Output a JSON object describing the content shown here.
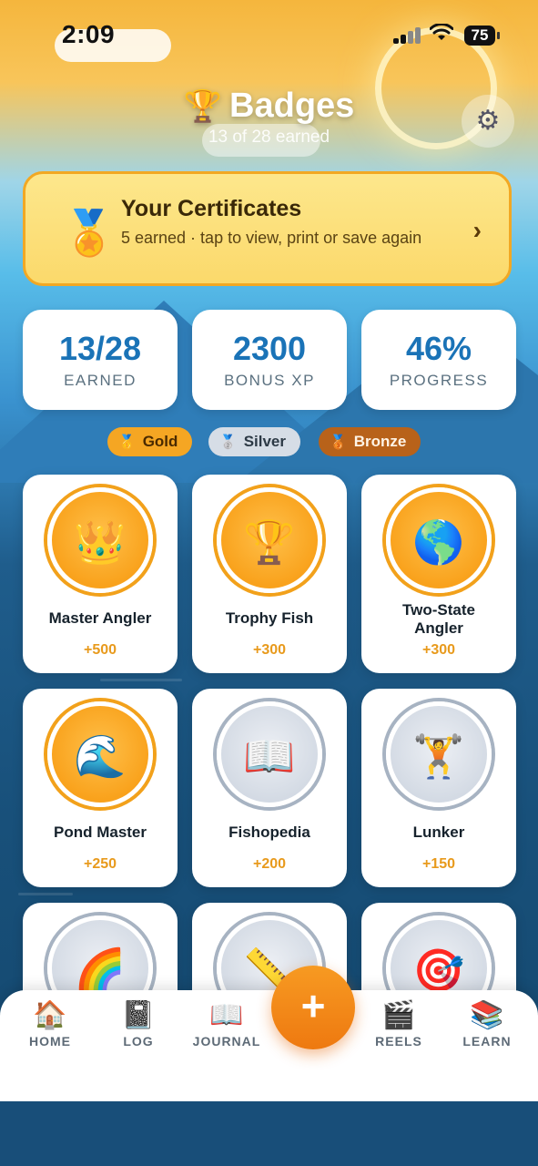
{
  "status_bar": {
    "time": "2:09",
    "battery": "75"
  },
  "header": {
    "title": "Badges",
    "subtitle": "13 of 28 earned"
  },
  "certificates": {
    "title": "Your Certificates",
    "description": "5 earned · tap to view, print or save again"
  },
  "stats": [
    {
      "value": "13/28",
      "label": "EARNED"
    },
    {
      "value": "2300",
      "label": "BONUS XP"
    },
    {
      "value": "46%",
      "label": "PROGRESS"
    }
  ],
  "legend": [
    {
      "label": "Gold",
      "icon": "gold-medal",
      "glyph": "🥇",
      "color": "#f5a623"
    },
    {
      "label": "Silver",
      "icon": "silver-medal",
      "glyph": "🥈",
      "color": "#d6dde6"
    },
    {
      "label": "Bronze",
      "icon": "bronze-medal",
      "glyph": "🥉",
      "color": "#b8621a"
    }
  ],
  "badges": [
    {
      "name": "Master Angler",
      "xp": "+500",
      "tier": "gold",
      "icon": "crown-icon",
      "glyph": "👑"
    },
    {
      "name": "Trophy Fish",
      "xp": "+300",
      "tier": "gold",
      "icon": "trophy-icon",
      "glyph": "🏆"
    },
    {
      "name": "Two-State Angler",
      "xp": "+300",
      "tier": "gold",
      "icon": "globe-icon",
      "glyph": "🌎"
    },
    {
      "name": "Pond Master",
      "xp": "+250",
      "tier": "gold",
      "icon": "wave-icon",
      "glyph": "🌊"
    },
    {
      "name": "Fishopedia",
      "xp": "+200",
      "tier": "silver",
      "icon": "book-icon",
      "glyph": "📖"
    },
    {
      "name": "Lunker",
      "xp": "+150",
      "tier": "silver",
      "icon": "weightlifter-icon",
      "glyph": "🏋️"
    },
    {
      "name": "",
      "xp": "",
      "tier": "silver",
      "icon": "rainbow-icon",
      "glyph": "🌈"
    },
    {
      "name": "",
      "xp": "",
      "tier": "silver",
      "icon": "ruler-icon",
      "glyph": "📏"
    },
    {
      "name": "",
      "xp": "",
      "tier": "silver",
      "icon": "target-icon",
      "glyph": "🎯"
    }
  ],
  "nav": [
    {
      "label": "HOME",
      "icon": "house-icon",
      "glyph": "🏠"
    },
    {
      "label": "LOG",
      "icon": "notebook-icon",
      "glyph": "📓"
    },
    {
      "label": "JOURNAL",
      "icon": "open-book-icon",
      "glyph": "📖"
    },
    {
      "label": "REELS",
      "icon": "clapper-icon",
      "glyph": "🎬"
    },
    {
      "label": "LEARN",
      "icon": "books-icon",
      "glyph": "📚"
    }
  ],
  "fab": {
    "label": "+"
  }
}
